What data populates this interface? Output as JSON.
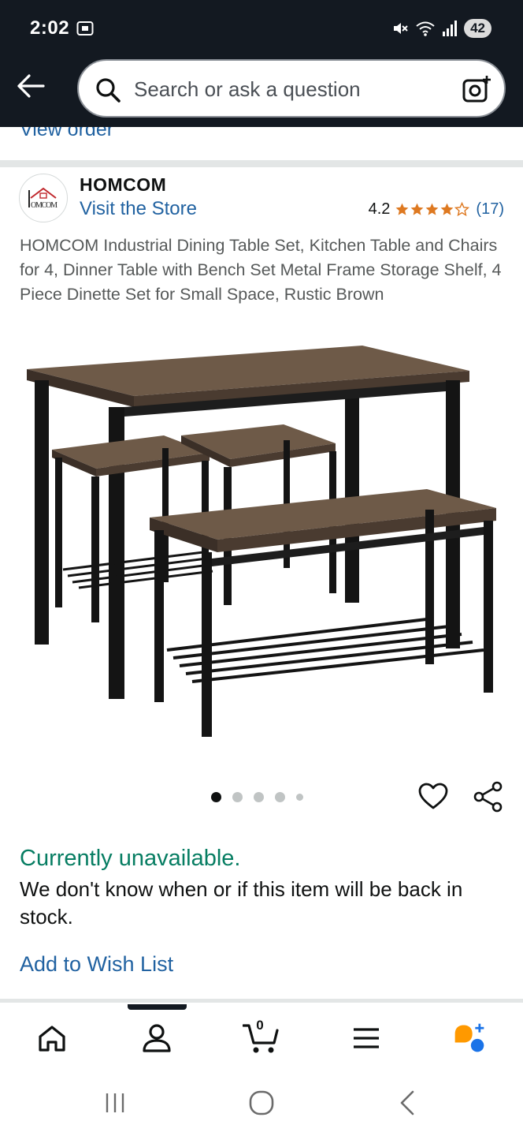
{
  "status_bar": {
    "time": "2:02",
    "battery": "42",
    "icons": [
      "screen-record-icon",
      "mute-icon",
      "wifi-icon",
      "signal-icon",
      "battery-icon"
    ]
  },
  "header": {
    "search_placeholder": "Search or ask a question",
    "icons": [
      "back-arrow-icon",
      "search-icon",
      "camera-lens-icon"
    ]
  },
  "previous_section": {
    "view_order_label": "View order"
  },
  "brand": {
    "logo_text": "HOMCOM",
    "name": "HOMCOM",
    "visit_store_label": "Visit the Store",
    "rating_value": "4.2",
    "stars": 4.2,
    "review_count": "(17)"
  },
  "product": {
    "title": "HOMCOM Industrial Dining Table Set, Kitchen Table and Chairs for 4, Dinner Table with Bench Set Metal Frame Storage Shelf, 4 Piece Dinette Set for Small Space, Rustic Brown",
    "image_count": 5,
    "active_image": 1
  },
  "availability": {
    "status": "Currently unavailable.",
    "message": "We don't know when or if this item will be back in stock."
  },
  "actions": {
    "add_to_wish_list": "Add to Wish List"
  },
  "bottom_nav": {
    "items": [
      "home-icon",
      "account-icon",
      "cart-icon",
      "menu-icon",
      "rufus-ai-icon"
    ],
    "cart_count": "0",
    "active": "account"
  },
  "colors": {
    "header_bg": "#131921",
    "link": "#2162a1",
    "available_green": "#067d62",
    "star": "#de7921",
    "rufus_orange": "#ff9900",
    "rufus_blue": "#1a73e8"
  }
}
